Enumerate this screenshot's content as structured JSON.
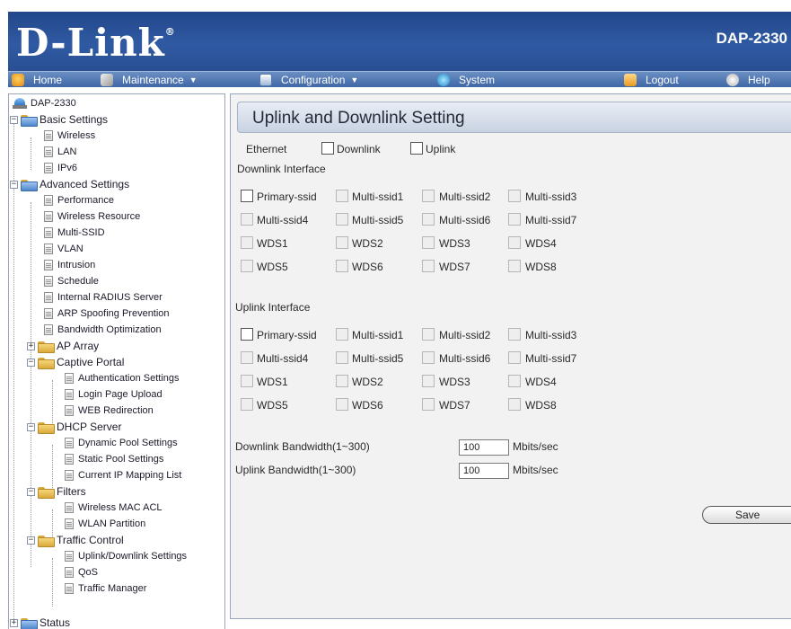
{
  "header": {
    "logo_text": "D-Link",
    "logo_mark": "®",
    "model": "DAP-2330"
  },
  "menu": [
    {
      "label": "Home",
      "icon": "home-icon",
      "color": "#f0a020"
    },
    {
      "label": "Maintenance",
      "icon": "wrench-icon",
      "color": "#d0d0d0",
      "dropdown": true
    },
    {
      "label": "Configuration",
      "icon": "disk-icon",
      "color": "#e6eef9",
      "dropdown": true
    },
    {
      "label": "System",
      "icon": "system-icon",
      "color": "#38b5e8"
    },
    {
      "label": "Logout",
      "icon": "logout-icon",
      "color": "#f0a020"
    },
    {
      "label": "Help",
      "icon": "help-icon",
      "color": "#e6e6e6"
    }
  ],
  "tree": {
    "root": "DAP-2330",
    "basic_settings": {
      "label": "Basic Settings",
      "items": [
        "Wireless",
        "LAN",
        "IPv6"
      ]
    },
    "advanced_settings": {
      "label": "Advanced Settings",
      "items": [
        "Performance",
        "Wireless Resource",
        "Multi-SSID",
        "VLAN",
        "Intrusion",
        "Schedule",
        "Internal RADIUS Server",
        "ARP Spoofing Prevention",
        "Bandwidth Optimization"
      ],
      "ap_array": "AP Array",
      "captive_portal": {
        "label": "Captive Portal",
        "items": [
          "Authentication Settings",
          "Login Page Upload",
          "WEB Redirection"
        ]
      },
      "dhcp_server": {
        "label": "DHCP Server",
        "items": [
          "Dynamic Pool Settings",
          "Static Pool Settings",
          "Current IP Mapping List"
        ]
      },
      "filters": {
        "label": "Filters",
        "items": [
          "Wireless MAC ACL",
          "WLAN Partition"
        ]
      },
      "traffic_control": {
        "label": "Traffic Control",
        "items": [
          "Uplink/Downlink Settings",
          "QoS",
          "Traffic Manager"
        ]
      }
    },
    "status": "Status"
  },
  "content": {
    "title": "Uplink and Downlink Setting",
    "ethernet": {
      "label": "Ethernet",
      "downlink": "Downlink",
      "uplink": "Uplink"
    },
    "downlink_interface": {
      "label": "Downlink Interface",
      "rows": [
        [
          "Primary-ssid",
          "Multi-ssid1",
          "Multi-ssid2",
          "Multi-ssid3"
        ],
        [
          "Multi-ssid4",
          "Multi-ssid5",
          "Multi-ssid6",
          "Multi-ssid7"
        ],
        [
          "WDS1",
          "WDS2",
          "WDS3",
          "WDS4"
        ],
        [
          "WDS5",
          "WDS6",
          "WDS7",
          "WDS8"
        ]
      ]
    },
    "uplink_interface": {
      "label": "Uplink Interface",
      "rows": [
        [
          "Primary-ssid",
          "Multi-ssid1",
          "Multi-ssid2",
          "Multi-ssid3"
        ],
        [
          "Multi-ssid4",
          "Multi-ssid5",
          "Multi-ssid6",
          "Multi-ssid7"
        ],
        [
          "WDS1",
          "WDS2",
          "WDS3",
          "WDS4"
        ],
        [
          "WDS5",
          "WDS6",
          "WDS7",
          "WDS8"
        ]
      ]
    },
    "downlink_bandwidth": {
      "label": "Downlink Bandwidth(1~300)",
      "value": "100",
      "unit": "Mbits/sec"
    },
    "uplink_bandwidth": {
      "label": "Uplink Bandwidth(1~300)",
      "value": "100",
      "unit": "Mbits/sec"
    },
    "save_label": "Save"
  }
}
